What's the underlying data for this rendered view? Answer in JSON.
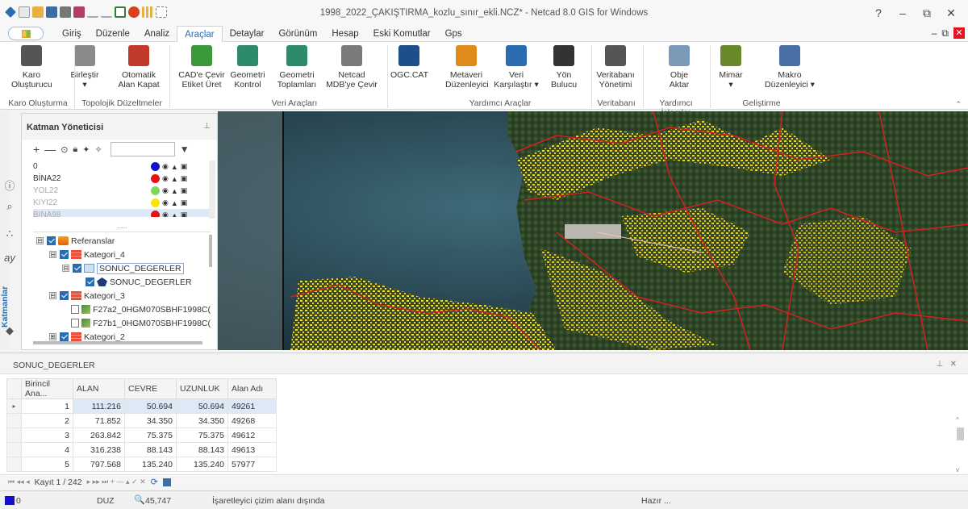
{
  "window": {
    "title": "1998_2022_ÇAKIŞTIRMA_kozlu_sınır_ekli.NCZ* - Netcad 8.0 GIS for Windows",
    "help": "?",
    "minimize": "–",
    "restore": "⧉",
    "close": "✕"
  },
  "menu": {
    "tabs": [
      "Giriş",
      "Düzenle",
      "Analiz",
      "Araçlar",
      "Detaylar",
      "Görünüm",
      "Hesap",
      "Eski Komutlar",
      "Gps"
    ],
    "active": "Araçlar",
    "mdi_minimize": "–",
    "mdi_restore": "⧉",
    "mdi_close": "✕"
  },
  "ribbon": {
    "buttons": [
      {
        "line1": "Karo",
        "line2": "Oluşturucu",
        "icon": "grid-icon",
        "color": "#555555"
      },
      {
        "line1": "Birleştir",
        "line2": "▾",
        "icon": "merge-icon",
        "color": "#8a8a8a"
      },
      {
        "line1": "Otomatik",
        "line2": "Alan Kapat",
        "icon": "auto-close-area-icon",
        "color": "#c0392b"
      },
      {
        "line1": "CAD'e Çevir",
        "line2": "Etiket Üret",
        "icon": "cad-convert-icon",
        "color": "#3a9a3a"
      },
      {
        "line1": "Geometri",
        "line2": "Kontrol",
        "icon": "geometry-check-icon",
        "color": "#2e8b6a"
      },
      {
        "line1": "Geometri",
        "line2": "Toplamları",
        "icon": "geometry-sum-icon",
        "color": "#2e8b6a"
      },
      {
        "line1": "Netcad",
        "line2": "MDB'ye Çevir",
        "icon": "gear-icon",
        "color": "#7a7a7a"
      },
      {
        "line1": "OGC.CAT",
        "line2": "",
        "icon": "ogc-icon",
        "color": "#1f4e8c"
      },
      {
        "line1": "Metaveri",
        "line2": "Düzenleyici",
        "icon": "metadata-icon",
        "color": "#e08a1a"
      },
      {
        "line1": "Veri",
        "line2": "Karşılaştır ▾",
        "icon": "compare-icon",
        "color": "#2b6cb0"
      },
      {
        "line1": "Yön",
        "line2": "Bulucu",
        "icon": "compass-icon",
        "color": "#333333"
      },
      {
        "line1": "Veritabanı",
        "line2": "Yönetimi",
        "icon": "database-icon",
        "color": "#555555"
      },
      {
        "line1": "Obje",
        "line2": "Aktar",
        "icon": "object-transfer-icon",
        "color": "#7a9ab8"
      },
      {
        "line1": "Mimar",
        "line2": "▾",
        "icon": "architect-icon",
        "color": "#6a8a2a"
      },
      {
        "line1": "Makro",
        "line2": "Düzenleyici ▾",
        "icon": "macro-editor-icon",
        "color": "#4a6fa5"
      }
    ],
    "groups": [
      "Karo Oluşturma",
      "Topolojik Düzeltmeler",
      "Veri Araçları",
      "Yardımcı Araçlar",
      "Veritabanı",
      "Yardımcı İşlemler",
      "Geliştirme"
    ],
    "collapse": "⌃"
  },
  "layer_manager": {
    "title": "Katman Yöneticisi",
    "pin": "⊥",
    "tools": {
      "add": "+",
      "remove": "—",
      "filter": "▼"
    },
    "search_placeholder": "",
    "layers": [
      {
        "name": "0",
        "color": "#1010d0",
        "dim": false
      },
      {
        "name": "BİNA22",
        "color": "#e81010",
        "dim": false
      },
      {
        "name": "YOL22",
        "color": "#7ed957",
        "dim": true
      },
      {
        "name": "KIYI22",
        "color": "#f5e60a",
        "dim": true
      },
      {
        "name": "BINA98",
        "color": "#e81010",
        "dim": true
      }
    ],
    "more": "....."
  },
  "tree": [
    {
      "label": "Referanslar",
      "indent": 0,
      "expander": "⊟",
      "checked": true,
      "icon": "ref"
    },
    {
      "label": "Kategori_4",
      "indent": 1,
      "expander": "⊟",
      "checked": true,
      "icon": "cat"
    },
    {
      "label": "SONUC_DEGERLER",
      "indent": 2,
      "expander": "⊟",
      "checked": true,
      "icon": "layer",
      "selected": true
    },
    {
      "label": "SONUC_DEGERLER",
      "indent": 3,
      "expander": "",
      "checked": true,
      "icon": "poly"
    },
    {
      "label": "Kategori_3",
      "indent": 1,
      "expander": "⊟",
      "checked": true,
      "icon": "cat"
    },
    {
      "label": "F27a2_0HGM070SBHF1998C(",
      "indent": 2,
      "expander": "",
      "checked": false,
      "icon": "img"
    },
    {
      "label": "F27b1_0HGM070SBHF1998C(",
      "indent": 2,
      "expander": "",
      "checked": false,
      "icon": "img"
    },
    {
      "label": "Kategori_2",
      "indent": 1,
      "expander": "⊞",
      "checked": true,
      "icon": "cat"
    }
  ],
  "side_tabs": {
    "label": "Katmanlar"
  },
  "attribute_table": {
    "title": "SONUC_DEGERLER",
    "pin": "⊥",
    "close": "✕",
    "columns": [
      "",
      "Birincil Ana...",
      "ALAN",
      "CEVRE",
      "UZUNLUK",
      "Alan Adı"
    ],
    "rows": [
      {
        "marker": "▸",
        "id": "1",
        "alan": "111.216",
        "cevre": "50.694",
        "uzunluk": "50.694",
        "ad": "49261"
      },
      {
        "marker": "",
        "id": "2",
        "alan": "71.852",
        "cevre": "34.350",
        "uzunluk": "34.350",
        "ad": "49268"
      },
      {
        "marker": "",
        "id": "3",
        "alan": "263.842",
        "cevre": "75.375",
        "uzunluk": "75.375",
        "ad": "49612"
      },
      {
        "marker": "",
        "id": "4",
        "alan": "316.238",
        "cevre": "88.143",
        "uzunluk": "88.143",
        "ad": "49613"
      },
      {
        "marker": "",
        "id": "5",
        "alan": "797.568",
        "cevre": "135.240",
        "uzunluk": "135.240",
        "ad": "57977"
      }
    ],
    "record_nav": "Kayıt 1 / 242",
    "nav_first": "⏮ ◂◂ ◂",
    "nav_next": "▸ ▸▸ ⏭ + — ▴ ✓ ✕"
  },
  "status": {
    "color_swatch": "#1010d0",
    "color_label": "0",
    "mode": "DUZ",
    "zoom_icon": "🔍",
    "zoom": "45,747",
    "message": "İşaretleyici çizim alanı dışında",
    "ready": "Hazır ..."
  }
}
